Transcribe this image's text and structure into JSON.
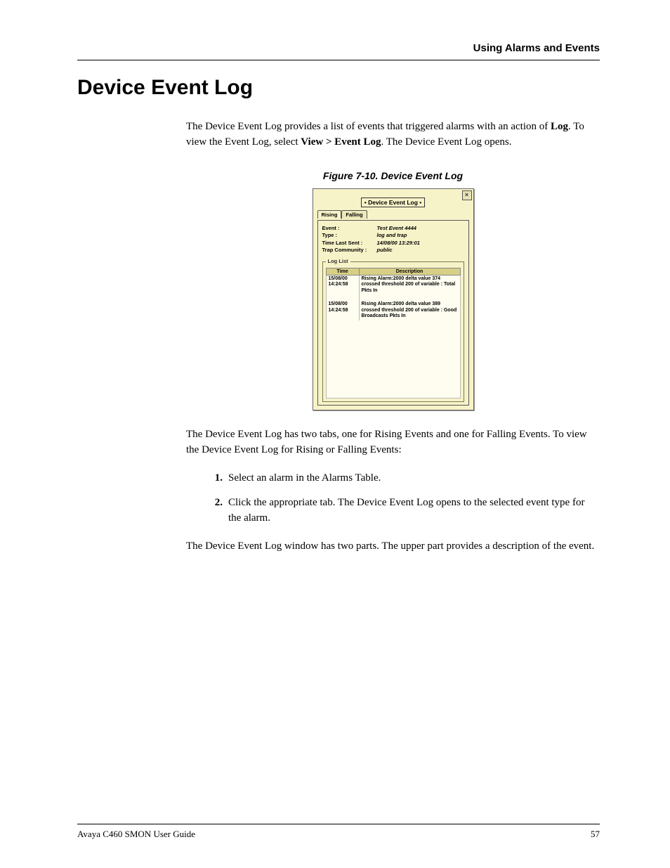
{
  "header": {
    "right": "Using Alarms and Events"
  },
  "title": "Device Event Log",
  "intro": {
    "p1a": "The Device Event Log provides a list of events that triggered alarms with an action of ",
    "p1b_bold": "Log",
    "p1c": ". To view the Event Log, select ",
    "p1d_bold": "View > Event Log",
    "p1e": ". The Device Event Log opens."
  },
  "figure_caption": "Figure 7-10.  Device Event Log",
  "dialog": {
    "title": "• Device Event Log •",
    "tabs": {
      "rising": "Rising",
      "falling": "Falling"
    },
    "info": {
      "event_label": "Event :",
      "event_value": "Test Event 4444",
      "type_label": "Type :",
      "type_value": "log and trap",
      "time_label": "Time Last Sent :",
      "time_value": "14/08/00 13:29:01",
      "trap_label": "Trap Community :",
      "trap_value": "public"
    },
    "loglist_legend": "Log List",
    "columns": {
      "time": "Time",
      "desc": "Description"
    },
    "rows": [
      {
        "date": "15/08/00",
        "time": "14:24:58",
        "desc": "Rising Alarm:2000 delta value 374 crossed threshold 200 of variable : Total Pkts In"
      },
      {
        "date": "15/08/00",
        "time": "14:24:58",
        "desc": "Rising Alarm:2000 delta value 389 crossed threshold 200 of variable : Good Broadcasts Pkts In"
      }
    ]
  },
  "after": {
    "p2": "The Device Event Log has two tabs, one for Rising Events and one for Falling Events. To view the Device Event Log for Rising or Falling Events:",
    "steps": [
      "Select an alarm in the Alarms Table.",
      "Click the appropriate tab. The Device Event Log opens to the selected event type for the alarm."
    ],
    "p3": "The Device Event Log window has two parts. The upper part provides a description of the event."
  },
  "footer": {
    "left": "Avaya C460 SMON User Guide",
    "right": "57"
  }
}
